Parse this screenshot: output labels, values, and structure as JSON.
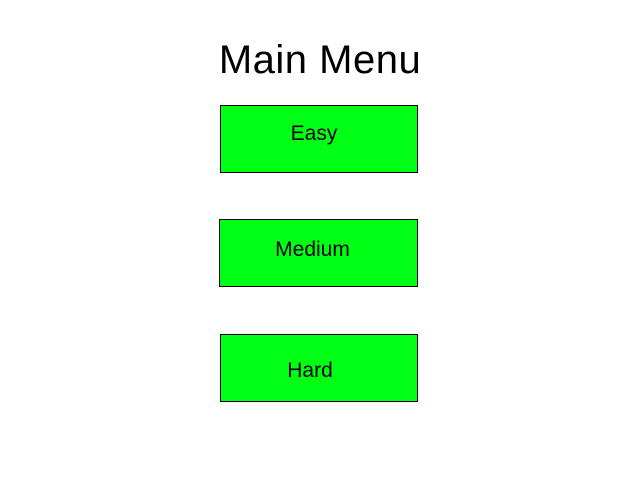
{
  "title": "Main Menu",
  "buttons": {
    "easy": "Easy",
    "medium": "Medium",
    "hard": "Hard"
  },
  "colors": {
    "background": "#ffffff",
    "button_fill": "#00ff14",
    "button_border": "#000000",
    "text": "#000000"
  }
}
